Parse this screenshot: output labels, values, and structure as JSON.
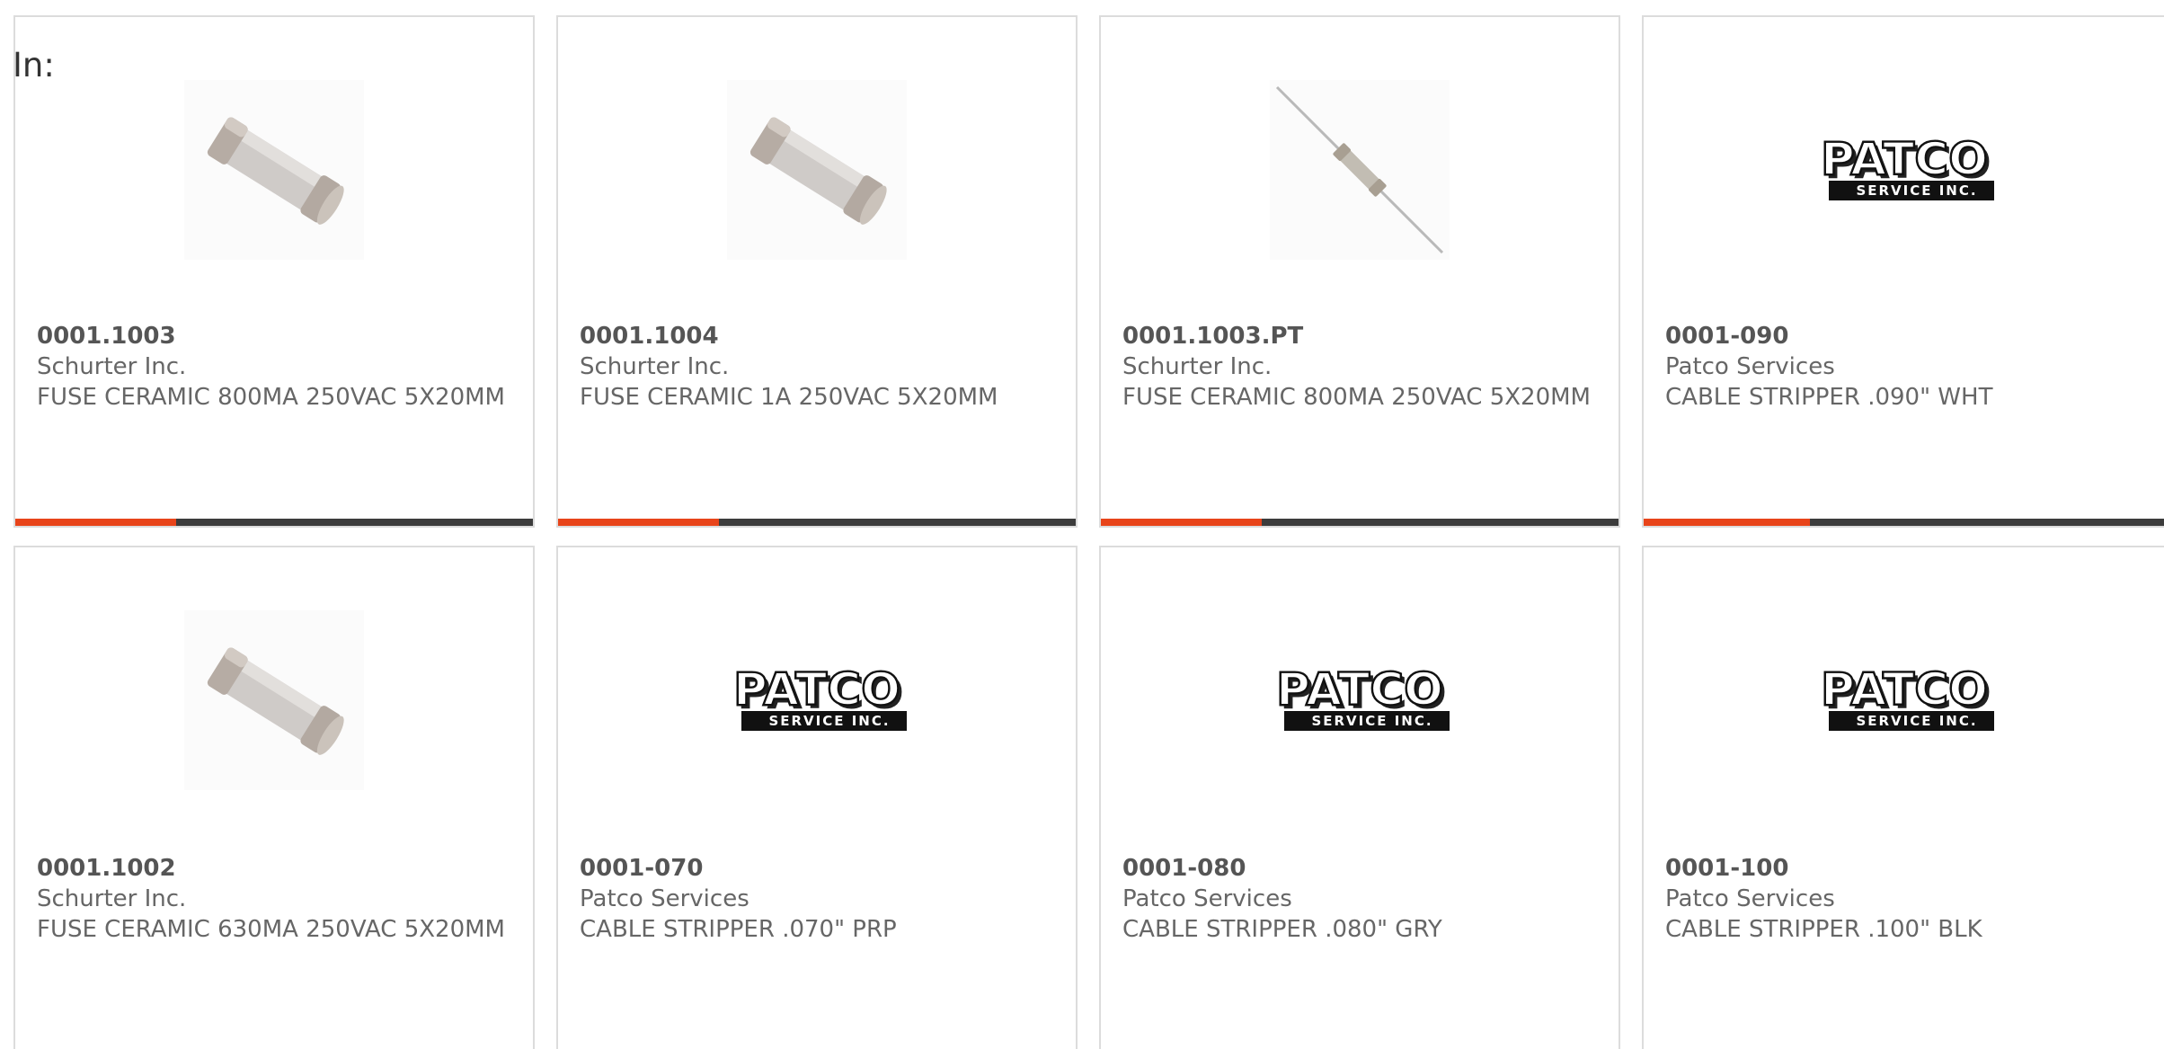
{
  "header": {
    "in_label": "In:"
  },
  "colors": {
    "accent": "#e8441a",
    "bar_track": "#3c3c3c",
    "border": "#dcdcdc",
    "text": "#666666"
  },
  "logo_text": {
    "patco_main": "PATCO",
    "patco_sub": "SERVICE INC."
  },
  "products": [
    {
      "part_number": "0001.1003",
      "manufacturer": "Schurter Inc.",
      "description": "FUSE CERAMIC 800MA 250VAC 5X20MM",
      "image": "ceramic-fuse-icon",
      "progress": 0.31
    },
    {
      "part_number": "0001.1004",
      "manufacturer": "Schurter Inc.",
      "description": "FUSE CERAMIC 1A 250VAC 5X20MM",
      "image": "ceramic-fuse-icon",
      "progress": 0.31
    },
    {
      "part_number": "0001.1003.PT",
      "manufacturer": "Schurter Inc.",
      "description": "FUSE CERAMIC 800MA 250VAC 5X20MM",
      "image": "axial-fuse-icon",
      "progress": 0.31
    },
    {
      "part_number": "0001-090",
      "manufacturer": "Patco Services",
      "description": "CABLE STRIPPER .090\" WHT",
      "image": "patco-logo",
      "progress": 0.31
    },
    {
      "part_number": "0001.1002",
      "manufacturer": "Schurter Inc.",
      "description": "FUSE CERAMIC 630MA 250VAC 5X20MM",
      "image": "ceramic-fuse-icon"
    },
    {
      "part_number": "0001-070",
      "manufacturer": "Patco Services",
      "description": "CABLE STRIPPER .070\" PRP",
      "image": "patco-logo"
    },
    {
      "part_number": "0001-080",
      "manufacturer": "Patco Services",
      "description": "CABLE STRIPPER .080\" GRY",
      "image": "patco-logo"
    },
    {
      "part_number": "0001-100",
      "manufacturer": "Patco Services",
      "description": "CABLE STRIPPER .100\" BLK",
      "image": "patco-logo"
    }
  ]
}
